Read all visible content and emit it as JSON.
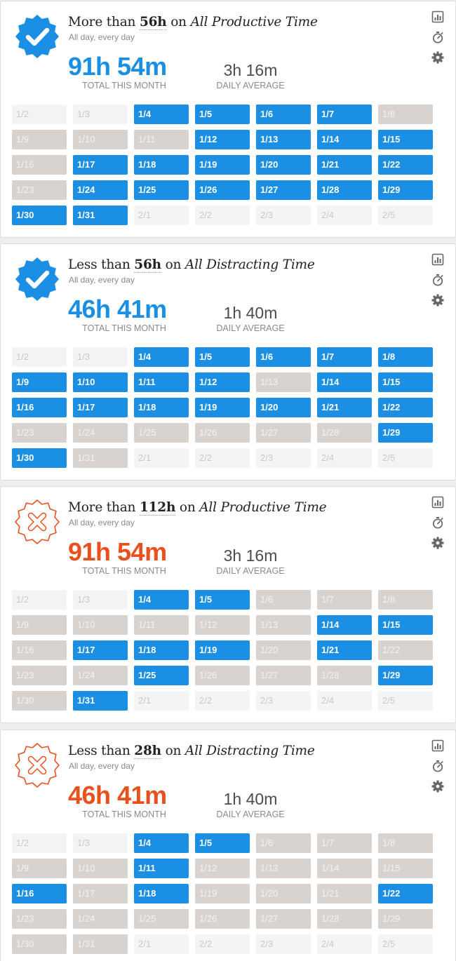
{
  "colors": {
    "met": "#1a8fe3",
    "missed": "#d8d3cf",
    "success": "#1a8fe3",
    "fail": "#e8501e"
  },
  "labels": {
    "total": "TOTAL THIS MONTH",
    "average": "DAILY AVERAGE",
    "schedule": "All day, every day"
  },
  "icons": [
    "reports-icon",
    "stopwatch-icon",
    "gear-icon"
  ],
  "goals": [
    {
      "status": "success",
      "prefix": "More than ",
      "amount": "56h",
      "middle": " on ",
      "category": "All Productive Time",
      "schedule": "All day, every day",
      "total": "91h 54m",
      "average": "3h 16m",
      "days": [
        {
          "label": "1/2",
          "state": "future"
        },
        {
          "label": "1/3",
          "state": "future"
        },
        {
          "label": "1/4",
          "state": "met"
        },
        {
          "label": "1/5",
          "state": "met"
        },
        {
          "label": "1/6",
          "state": "met"
        },
        {
          "label": "1/7",
          "state": "met"
        },
        {
          "label": "1/8",
          "state": "missed"
        },
        {
          "label": "1/9",
          "state": "missed"
        },
        {
          "label": "1/10",
          "state": "missed"
        },
        {
          "label": "1/11",
          "state": "missed"
        },
        {
          "label": "1/12",
          "state": "met"
        },
        {
          "label": "1/13",
          "state": "met"
        },
        {
          "label": "1/14",
          "state": "met"
        },
        {
          "label": "1/15",
          "state": "met"
        },
        {
          "label": "1/16",
          "state": "missed"
        },
        {
          "label": "1/17",
          "state": "met"
        },
        {
          "label": "1/18",
          "state": "met"
        },
        {
          "label": "1/19",
          "state": "met"
        },
        {
          "label": "1/20",
          "state": "met"
        },
        {
          "label": "1/21",
          "state": "met"
        },
        {
          "label": "1/22",
          "state": "met"
        },
        {
          "label": "1/23",
          "state": "missed"
        },
        {
          "label": "1/24",
          "state": "met"
        },
        {
          "label": "1/25",
          "state": "met"
        },
        {
          "label": "1/26",
          "state": "met"
        },
        {
          "label": "1/27",
          "state": "met"
        },
        {
          "label": "1/28",
          "state": "met"
        },
        {
          "label": "1/29",
          "state": "met"
        },
        {
          "label": "1/30",
          "state": "met"
        },
        {
          "label": "1/31",
          "state": "met"
        },
        {
          "label": "2/1",
          "state": "future"
        },
        {
          "label": "2/2",
          "state": "future"
        },
        {
          "label": "2/3",
          "state": "future"
        },
        {
          "label": "2/4",
          "state": "future"
        },
        {
          "label": "2/5",
          "state": "future"
        }
      ]
    },
    {
      "status": "success",
      "prefix": "Less than ",
      "amount": "56h",
      "middle": " on ",
      "category": "All Distracting Time",
      "schedule": "All day, every day",
      "total": "46h 41m",
      "average": "1h 40m",
      "days": [
        {
          "label": "1/2",
          "state": "future"
        },
        {
          "label": "1/3",
          "state": "future"
        },
        {
          "label": "1/4",
          "state": "met"
        },
        {
          "label": "1/5",
          "state": "met"
        },
        {
          "label": "1/6",
          "state": "met"
        },
        {
          "label": "1/7",
          "state": "met"
        },
        {
          "label": "1/8",
          "state": "met"
        },
        {
          "label": "1/9",
          "state": "met"
        },
        {
          "label": "1/10",
          "state": "met"
        },
        {
          "label": "1/11",
          "state": "met"
        },
        {
          "label": "1/12",
          "state": "met"
        },
        {
          "label": "1/13",
          "state": "missed"
        },
        {
          "label": "1/14",
          "state": "met"
        },
        {
          "label": "1/15",
          "state": "met"
        },
        {
          "label": "1/16",
          "state": "met"
        },
        {
          "label": "1/17",
          "state": "met"
        },
        {
          "label": "1/18",
          "state": "met"
        },
        {
          "label": "1/19",
          "state": "met"
        },
        {
          "label": "1/20",
          "state": "met"
        },
        {
          "label": "1/21",
          "state": "met"
        },
        {
          "label": "1/22",
          "state": "met"
        },
        {
          "label": "1/23",
          "state": "missed"
        },
        {
          "label": "1/24",
          "state": "missed"
        },
        {
          "label": "1/25",
          "state": "missed"
        },
        {
          "label": "1/26",
          "state": "missed"
        },
        {
          "label": "1/27",
          "state": "missed"
        },
        {
          "label": "1/28",
          "state": "missed"
        },
        {
          "label": "1/29",
          "state": "met"
        },
        {
          "label": "1/30",
          "state": "met"
        },
        {
          "label": "1/31",
          "state": "missed"
        },
        {
          "label": "2/1",
          "state": "future"
        },
        {
          "label": "2/2",
          "state": "future"
        },
        {
          "label": "2/3",
          "state": "future"
        },
        {
          "label": "2/4",
          "state": "future"
        },
        {
          "label": "2/5",
          "state": "future"
        }
      ]
    },
    {
      "status": "fail",
      "prefix": "More than ",
      "amount": "112h",
      "middle": " on ",
      "category": "All Productive Time",
      "schedule": "All day, every day",
      "total": "91h 54m",
      "average": "3h 16m",
      "days": [
        {
          "label": "1/2",
          "state": "future"
        },
        {
          "label": "1/3",
          "state": "future"
        },
        {
          "label": "1/4",
          "state": "met"
        },
        {
          "label": "1/5",
          "state": "met"
        },
        {
          "label": "1/6",
          "state": "missed"
        },
        {
          "label": "1/7",
          "state": "missed"
        },
        {
          "label": "1/8",
          "state": "missed"
        },
        {
          "label": "1/9",
          "state": "missed"
        },
        {
          "label": "1/10",
          "state": "missed"
        },
        {
          "label": "1/11",
          "state": "missed"
        },
        {
          "label": "1/12",
          "state": "missed"
        },
        {
          "label": "1/13",
          "state": "missed"
        },
        {
          "label": "1/14",
          "state": "met"
        },
        {
          "label": "1/15",
          "state": "met"
        },
        {
          "label": "1/16",
          "state": "missed"
        },
        {
          "label": "1/17",
          "state": "met"
        },
        {
          "label": "1/18",
          "state": "met"
        },
        {
          "label": "1/19",
          "state": "met"
        },
        {
          "label": "1/20",
          "state": "missed"
        },
        {
          "label": "1/21",
          "state": "met"
        },
        {
          "label": "1/22",
          "state": "missed"
        },
        {
          "label": "1/23",
          "state": "missed"
        },
        {
          "label": "1/24",
          "state": "missed"
        },
        {
          "label": "1/25",
          "state": "met"
        },
        {
          "label": "1/26",
          "state": "missed"
        },
        {
          "label": "1/27",
          "state": "missed"
        },
        {
          "label": "1/28",
          "state": "missed"
        },
        {
          "label": "1/29",
          "state": "met"
        },
        {
          "label": "1/30",
          "state": "missed"
        },
        {
          "label": "1/31",
          "state": "met"
        },
        {
          "label": "2/1",
          "state": "future"
        },
        {
          "label": "2/2",
          "state": "future"
        },
        {
          "label": "2/3",
          "state": "future"
        },
        {
          "label": "2/4",
          "state": "future"
        },
        {
          "label": "2/5",
          "state": "future"
        }
      ]
    },
    {
      "status": "fail",
      "prefix": "Less than ",
      "amount": "28h",
      "middle": " on ",
      "category": "All Distracting Time",
      "schedule": "All day, every day",
      "total": "46h 41m",
      "average": "1h 40m",
      "days": [
        {
          "label": "1/2",
          "state": "future"
        },
        {
          "label": "1/3",
          "state": "future"
        },
        {
          "label": "1/4",
          "state": "met"
        },
        {
          "label": "1/5",
          "state": "met"
        },
        {
          "label": "1/6",
          "state": "missed"
        },
        {
          "label": "1/7",
          "state": "missed"
        },
        {
          "label": "1/8",
          "state": "missed"
        },
        {
          "label": "1/9",
          "state": "missed"
        },
        {
          "label": "1/10",
          "state": "missed"
        },
        {
          "label": "1/11",
          "state": "met"
        },
        {
          "label": "1/12",
          "state": "missed"
        },
        {
          "label": "1/13",
          "state": "missed"
        },
        {
          "label": "1/14",
          "state": "missed"
        },
        {
          "label": "1/15",
          "state": "missed"
        },
        {
          "label": "1/16",
          "state": "met"
        },
        {
          "label": "1/17",
          "state": "missed"
        },
        {
          "label": "1/18",
          "state": "met"
        },
        {
          "label": "1/19",
          "state": "missed"
        },
        {
          "label": "1/20",
          "state": "missed"
        },
        {
          "label": "1/21",
          "state": "missed"
        },
        {
          "label": "1/22",
          "state": "met"
        },
        {
          "label": "1/23",
          "state": "missed"
        },
        {
          "label": "1/24",
          "state": "missed"
        },
        {
          "label": "1/25",
          "state": "missed"
        },
        {
          "label": "1/26",
          "state": "missed"
        },
        {
          "label": "1/27",
          "state": "missed"
        },
        {
          "label": "1/28",
          "state": "missed"
        },
        {
          "label": "1/29",
          "state": "missed"
        },
        {
          "label": "1/30",
          "state": "missed"
        },
        {
          "label": "1/31",
          "state": "missed"
        },
        {
          "label": "2/1",
          "state": "future"
        },
        {
          "label": "2/2",
          "state": "future"
        },
        {
          "label": "2/3",
          "state": "future"
        },
        {
          "label": "2/4",
          "state": "future"
        },
        {
          "label": "2/5",
          "state": "future"
        }
      ]
    }
  ]
}
